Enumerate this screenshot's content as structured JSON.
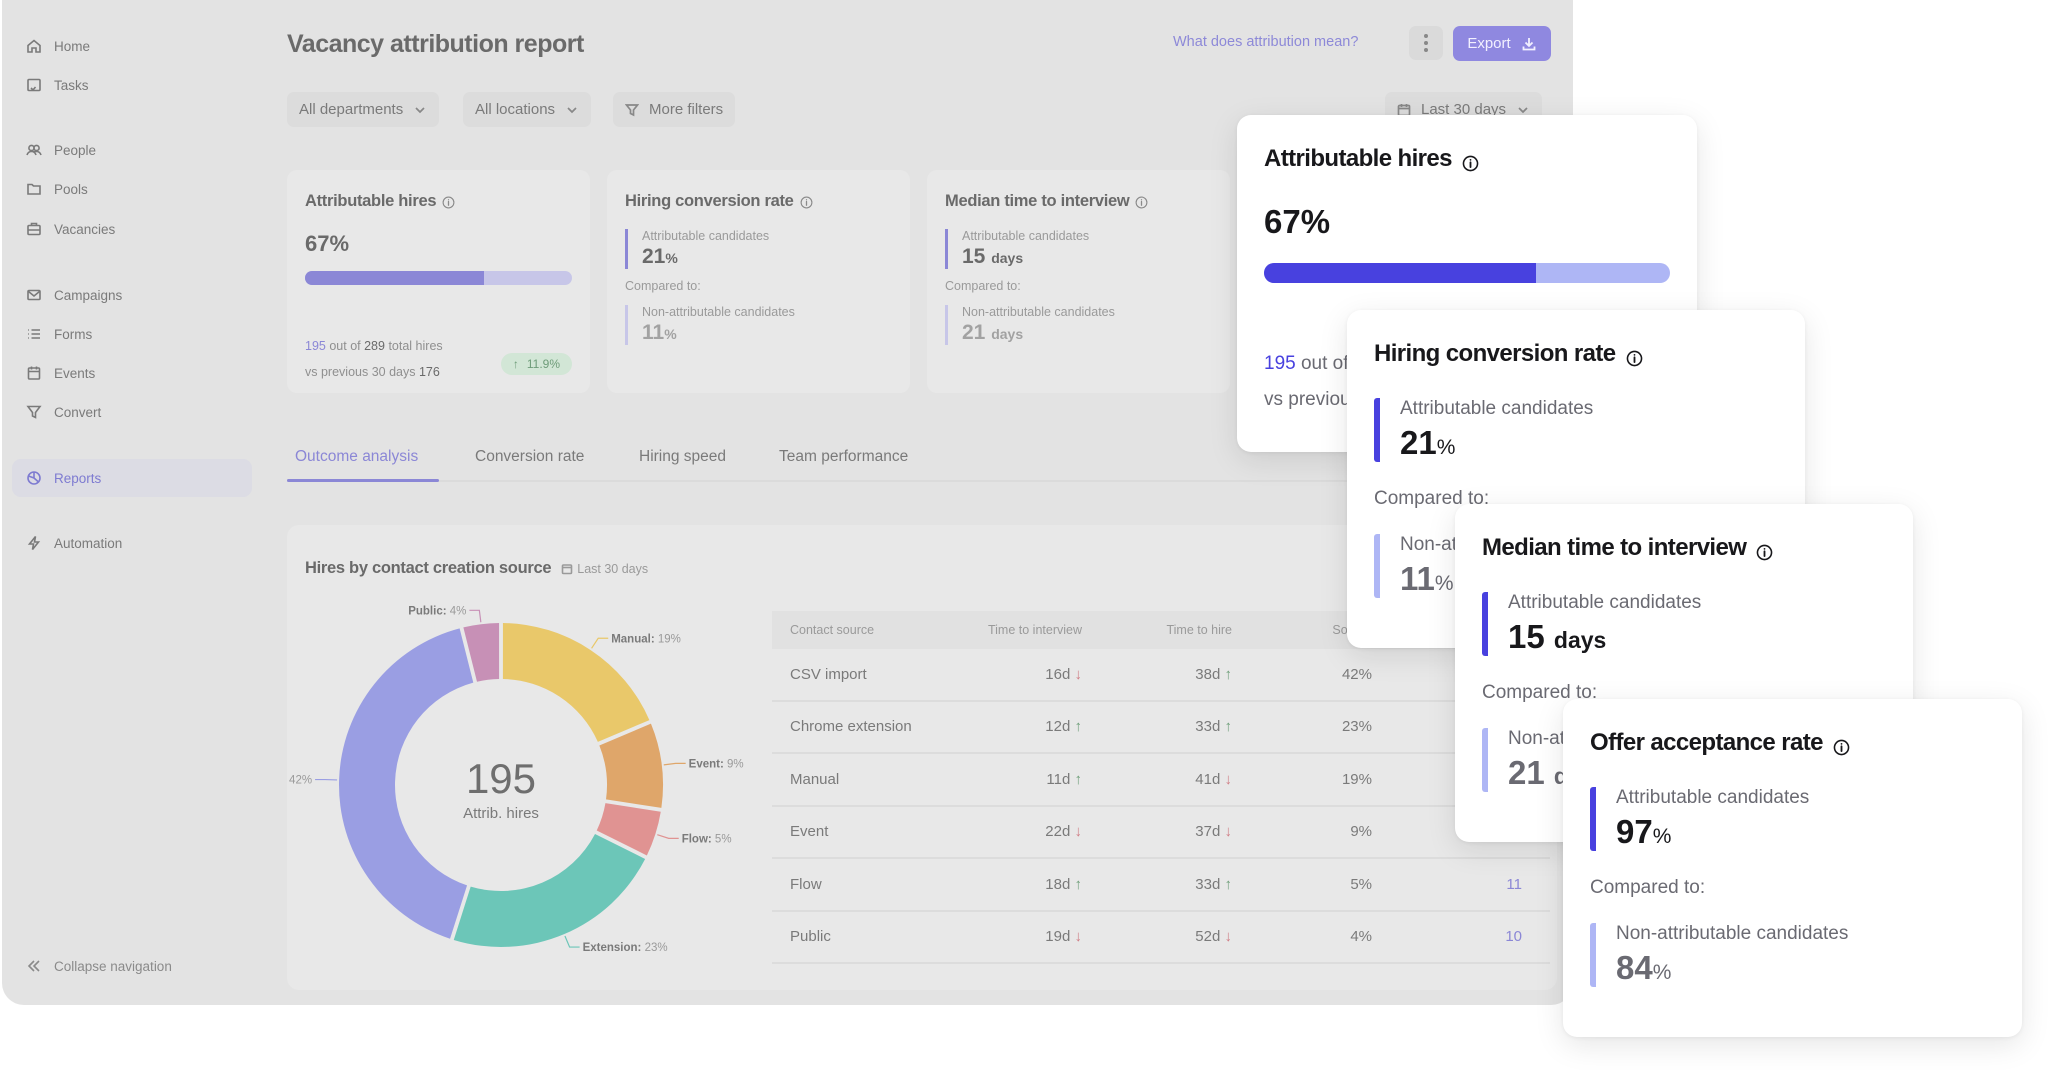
{
  "sidebar": {
    "items": [
      {
        "label": "Home",
        "icon": "home-icon"
      },
      {
        "label": "Tasks",
        "icon": "tasks-icon"
      },
      {
        "label": "People",
        "icon": "people-icon"
      },
      {
        "label": "Pools",
        "icon": "folder-icon"
      },
      {
        "label": "Vacancies",
        "icon": "briefcase-icon"
      },
      {
        "label": "Campaigns",
        "icon": "mail-icon"
      },
      {
        "label": "Forms",
        "icon": "list-icon"
      },
      {
        "label": "Events",
        "icon": "calendar-icon"
      },
      {
        "label": "Convert",
        "icon": "filter-icon"
      },
      {
        "label": "Reports",
        "icon": "pie-chart-icon",
        "active": true
      },
      {
        "label": "Automation",
        "icon": "lightning-icon"
      }
    ],
    "collapse_label": "Collapse navigation"
  },
  "header": {
    "title": "Vacancy attribution report",
    "help_link": "What does attribution mean?",
    "export_label": "Export"
  },
  "filters": {
    "department": "All departments",
    "location": "All locations",
    "more": "More filters",
    "date_range": "Last 30 days"
  },
  "stats": {
    "attributable_hires": {
      "title": "Attributable hires",
      "value": "67%",
      "progress": 0.67,
      "count": "195",
      "count_text": "out of",
      "total": "289",
      "total_text": "total hires",
      "previous_text": "vs previous 30 days",
      "previous_value": "176",
      "trend": "11.9%",
      "trend_direction": "up"
    },
    "hiring_conversion": {
      "title": "Hiring conversion rate",
      "attr_label": "Attributable candidates",
      "attr_value": "21",
      "attr_unit": "%",
      "compared": "Compared to:",
      "non_label": "Non-attributable candidates",
      "non_value": "11",
      "non_unit": "%"
    },
    "median_time": {
      "title": "Median time to interview",
      "attr_label": "Attributable candidates",
      "attr_value": "15",
      "attr_unit": "days",
      "compared": "Compared to:",
      "non_label": "Non-attributable candidates",
      "non_value": "21",
      "non_unit": "days"
    },
    "offer_acceptance": {
      "title": "Offer acceptance rate",
      "attr_label": "Attributable candidates",
      "attr_value": "97",
      "attr_unit": "%",
      "compared": "Compared to:",
      "non_label": "Non-attributable candidates",
      "non_value": "84",
      "non_unit": "%"
    }
  },
  "tabs": [
    {
      "label": "Outcome analysis",
      "active": true
    },
    {
      "label": "Conversion rate"
    },
    {
      "label": "Hiring speed"
    },
    {
      "label": "Team performance"
    }
  ],
  "hires_panel": {
    "title": "Hires by contact creation source",
    "period": "Last 30 days",
    "center_value": "195",
    "center_label": "Attrib. hires"
  },
  "chart_data": {
    "type": "pie",
    "title": "Hires by contact creation source",
    "center_label": "195 Attrib. hires",
    "slices": [
      {
        "label": "Manual",
        "value": 19,
        "color": "#e9c86a"
      },
      {
        "label": "Event",
        "value": 9,
        "color": "#dfa66a"
      },
      {
        "label": "Flow",
        "value": 5,
        "color": "#e09392"
      },
      {
        "label": "Extension",
        "value": 23,
        "color": "#6cc6b8"
      },
      {
        "label": "CSV",
        "value": 42,
        "color": "#9a9ee3"
      },
      {
        "label": "Public",
        "value": 4,
        "color": "#c790b6"
      }
    ]
  },
  "table": {
    "headers": [
      "Contact source",
      "Time to interview",
      "Time to hire",
      "Source",
      ""
    ],
    "rows": [
      {
        "source": "CSV import",
        "tti": "16d",
        "tti_dir": "down",
        "tth": "38d",
        "tth_dir": "up",
        "share": "42%",
        "count": ""
      },
      {
        "source": "Chrome extension",
        "tti": "12d",
        "tti_dir": "up",
        "tth": "33d",
        "tth_dir": "up",
        "share": "23%",
        "count": ""
      },
      {
        "source": "Manual",
        "tti": "11d",
        "tti_dir": "up",
        "tth": "41d",
        "tth_dir": "down",
        "share": "19%",
        "count": ""
      },
      {
        "source": "Event",
        "tti": "22d",
        "tti_dir": "down",
        "tth": "37d",
        "tth_dir": "down",
        "share": "9%",
        "count": ""
      },
      {
        "source": "Flow",
        "tti": "18d",
        "tti_dir": "up",
        "tth": "33d",
        "tth_dir": "up",
        "share": "5%",
        "count": "11"
      },
      {
        "source": "Public",
        "tti": "19d",
        "tti_dir": "down",
        "tth": "52d",
        "tth_dir": "down",
        "share": "4%",
        "count": "10"
      }
    ]
  },
  "colors": {
    "accent": "#4841df",
    "accent_light": "#aeb6f5",
    "trend_up": "#6f9f7a",
    "trend_down": "#d07f86"
  }
}
